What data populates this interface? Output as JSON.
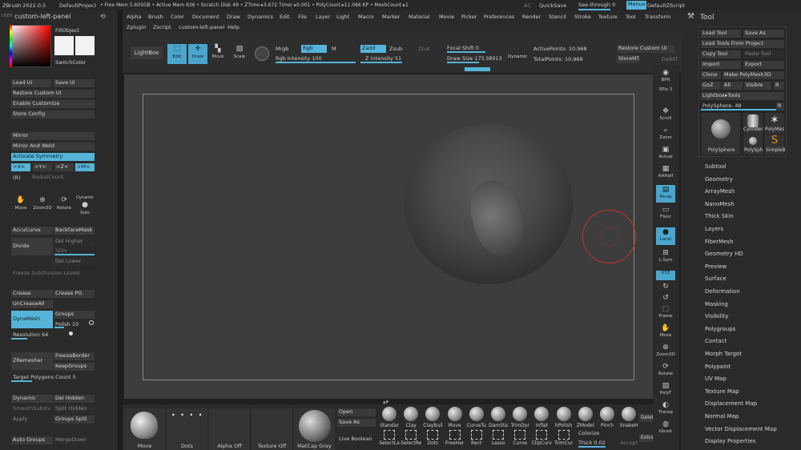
{
  "titlebar": {
    "app": "ZBrush 2022.0.5",
    "project": "DefaultProject",
    "stats": "• Free Mem 5.605GB • Active Mem 636 • Scratch Disk 49 • ZTime ▸3.672 Timer ▸0.001 • PolyCount ▸11.066 KP • MeshCount ▸1",
    "ac": "AC",
    "quicksave": "QuickSave",
    "see_through": "See-through 0",
    "menus_btn": "Menus",
    "default_zscript": "DefaultZScript"
  },
  "left_panel": {
    "user_label": "USER",
    "title": "custom-left-panel",
    "fill_object": "FillObject",
    "switch_color": "SwitchColor",
    "load_ui": "Load Ui",
    "save_ui": "Save Ui",
    "restore_custom_ui": "Restore Custom UI",
    "enable_customize": "Enable Customize",
    "store_config": "Store Config",
    "mirror": "Mirror",
    "mirror_and_weld": "Mirror And Weld",
    "activate_symmetry": "Activate Symmetry",
    "sym_x": ">X<",
    "sym_y": ">Y<",
    "sym_z": ">Z<",
    "sym_m": ">M<",
    "sym_r": "(R)",
    "radial_count": "RadialCount",
    "move": "Move",
    "zoom3d": "Zoom3D",
    "rotate": "Rotate",
    "dynamic_solo": "Dynamic",
    "solo": "Solo",
    "accucurve": "AccuCurve",
    "backfacemask": "BackfaceMask",
    "divide": "Divide",
    "del_higher": "Del Higher",
    "sdiv": "SDiv",
    "del_lower": "Del Lower",
    "freeze_subdiv": "Freeze SubDivision Levels",
    "crease": "Crease",
    "crease_pg": "Crease PG",
    "uncrease_all": "UnCreaseAll",
    "dynamesh": "DynaMesh",
    "groups": "Groups",
    "polish_label": "Polish",
    "polish_value": "10",
    "resolution_label": "Resolution",
    "resolution_value": "64",
    "zremesher": "ZRemesher",
    "freeze_border": "FreezeBorder",
    "keep_groups": "KeepGroups",
    "target_polygons_label": "Target Polygons Count",
    "target_polygons_value": "5",
    "dynamic": "Dynamic",
    "del_hidden": "Del Hidden",
    "smooth_subdiv": "SmoothSubdiv",
    "split_hidden": "Split Hidden",
    "apply": "Apply",
    "groups_split": "Groups Split",
    "auto_groups": "Auto Groups",
    "merge_down": "MergeDown"
  },
  "top_menu": [
    "Alpha",
    "Brush",
    "Color",
    "Document",
    "Draw",
    "Dynamics",
    "Edit",
    "File",
    "Layer",
    "Light",
    "Macro",
    "Marker",
    "Material",
    "Movie",
    "Picker",
    "Preferences",
    "Render",
    "Stencil",
    "Stroke",
    "Texture",
    "Tool",
    "Transform"
  ],
  "top_menu2": [
    "Zplugin",
    "Zscript",
    "custom-left-panel",
    "Help"
  ],
  "toolbar": {
    "lightbox": "LightBox",
    "edit": "Edit",
    "draw": "Draw",
    "move": "Move",
    "scale": "Scale",
    "rotate": "Rotate",
    "mrgb": "Mrgb",
    "rgb": "Rgb",
    "m": "M",
    "rgb_intensity_label": "Rgb Intensity",
    "rgb_intensity_value": "100",
    "zadd": "Zadd",
    "zsub": "Zsub",
    "zcut": "Zcut",
    "z_intensity_label": "Z Intensity",
    "z_intensity_value": "51",
    "focal_shift_label": "Focal Shift",
    "focal_shift_value": "0",
    "draw_size_label": "Draw Size",
    "draw_size_value": "175",
    "dynamic": "Dynamic",
    "draw_size_extra": "38913",
    "active_points": "ActivePoints: 10,968",
    "total_points": "TotalPoints: 10,968",
    "restore_custom_ui": "Restore Custom UI",
    "store_mt": "StoreMT",
    "del_mt": "DelMT"
  },
  "right_shelf": [
    {
      "label": "BPR",
      "icon": "◉"
    },
    {
      "label": "SPix 3",
      "icon": ""
    },
    {
      "label": "Scroll",
      "icon": "✥"
    },
    {
      "label": "Zoom",
      "icon": "⌕"
    },
    {
      "label": "Actual",
      "icon": "▣"
    },
    {
      "label": "AAHalf",
      "icon": "▦"
    },
    {
      "label": "Persp",
      "icon": "▤"
    },
    {
      "label": "Floor",
      "icon": "▭"
    },
    {
      "label": "Local",
      "icon": "●"
    },
    {
      "label": "L.Sym",
      "icon": "⊞"
    },
    {
      "label": "XYZ",
      "icon": ""
    },
    {
      "label": "",
      "icon": "↻"
    },
    {
      "label": "",
      "icon": "↺"
    },
    {
      "label": "Frame",
      "icon": "⬚"
    },
    {
      "label": "Move",
      "icon": "✋"
    },
    {
      "label": "Zoom3D",
      "icon": "⊕"
    },
    {
      "label": "Rotate",
      "icon": "⟳"
    },
    {
      "label": "PolyF",
      "icon": "▧"
    },
    {
      "label": "Transp",
      "icon": "◐"
    },
    {
      "label": "Ghost",
      "icon": "◍"
    }
  ],
  "tool_panel": {
    "title": "Tool",
    "load_tool": "Load Tool",
    "save_as": "Save As",
    "load_tools_from_project": "Load Tools From Project",
    "copy_tool": "Copy Tool",
    "paste_tool": "Paste Tool",
    "import": "Import",
    "export": "Export",
    "clone": "Clone",
    "make_polymesh3d": "Make PolyMesh3D",
    "goz": "GoZ",
    "all": "All",
    "visible": "Visible",
    "r": "R",
    "lightbox_tools": "Lightbox▸Tools",
    "polysphere_label": "PolySphere.",
    "polysphere_value": "48",
    "thumb_main": "PolySphere",
    "thumb_cylinder": "Cylinder",
    "thumb_polymesh": "PolyMes",
    "thumb_polysph": "PolySph",
    "thumb_simpleb": "SimpleB",
    "items": [
      "Subtool",
      "Geometry",
      "ArrayMesh",
      "NanoMesh",
      "Thick Skin",
      "Layers",
      "FiberMesh",
      "Geometry HD",
      "Preview",
      "Surface",
      "Deformation",
      "Masking",
      "Visibility",
      "Polygroups",
      "Contact",
      "Morph Target",
      "Polypaint",
      "UV Map",
      "Texture Map",
      "Displacement Map",
      "Normal Map",
      "Vector Displacement Map",
      "Display Properties"
    ]
  },
  "bottom": {
    "tiles": [
      "Move",
      "Dots",
      "Alpha Off",
      "Texture Off",
      "MatCap Gray"
    ],
    "open": "Open",
    "save_as": "Save As",
    "live_boolean": "Live Boolean",
    "brushes_top": [
      "Standar",
      "Clay",
      "ClayBuil",
      "Move",
      "CurveTu",
      "DamSta",
      "TrimDyr",
      "Inflat",
      "hPolish",
      "ZModel",
      "Pinch",
      "SnakeH"
    ],
    "brushes_bottom": [
      "SelectLa",
      "SelectRe",
      "Dots",
      "FreeHar",
      "Rect",
      "Lasso",
      "Curve",
      "ClipCurv",
      "TrimCur"
    ],
    "delete": "Delet",
    "extract": "Extra",
    "colorize": "Colorize",
    "thick_label": "Thick",
    "thick_value": "0.02",
    "accept": "Accept"
  },
  "colors": {
    "accent": "#56b4d8",
    "panel": "#2a2a2a",
    "canvas": "#3a3a3a",
    "cursor_ring": "#c83030"
  }
}
